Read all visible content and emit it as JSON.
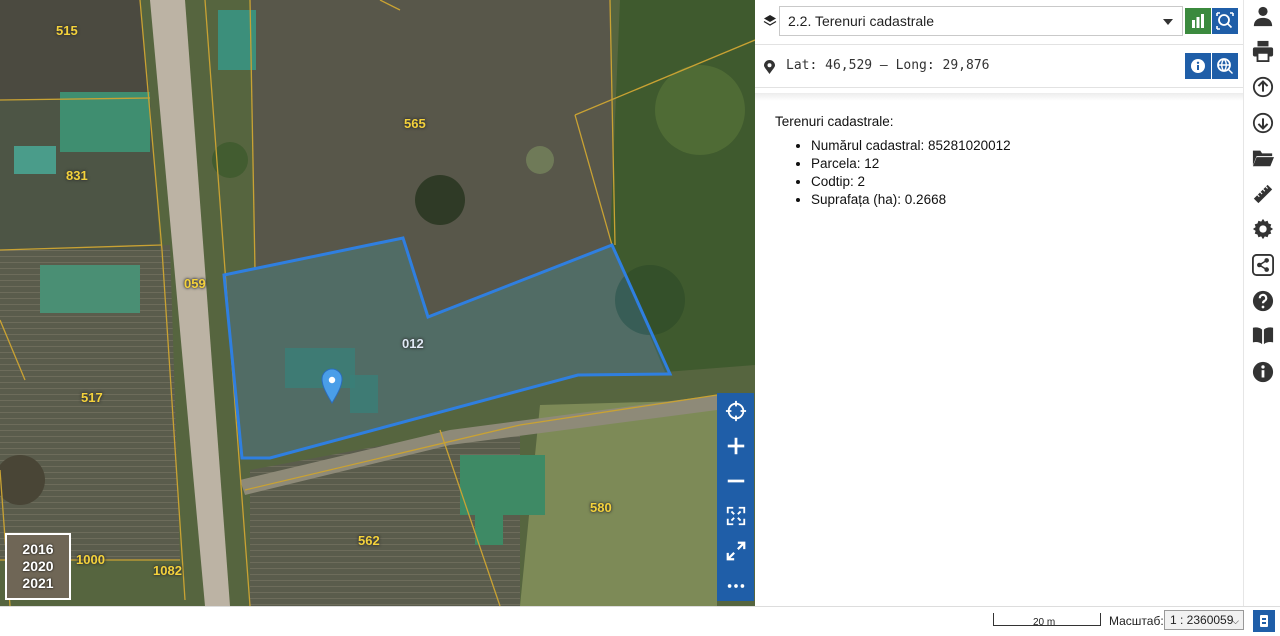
{
  "map": {
    "parcel_labels": [
      "515",
      "565",
      "831",
      "059",
      "012",
      "517",
      "580",
      "562",
      "1000",
      "1082"
    ],
    "years": [
      "2016",
      "2020",
      "2021"
    ],
    "controls": [
      "locate-icon",
      "zoom-in-icon",
      "zoom-out-icon",
      "fullscreen-icon",
      "expand-icon",
      "more-icon"
    ]
  },
  "panel": {
    "layer_select": "2.2. Terenuri cadastrale",
    "coords": "Lat: 46,529 – Long: 29,876",
    "title": "Terenuri cadastrale:",
    "attributes": [
      "Numărul cadastral: 85281020012",
      "Parcela: 12",
      "Codtip: 2",
      "Suprafața (ha): 0.2668"
    ]
  },
  "toolbar": {
    "icons": [
      "user-icon",
      "print-icon",
      "upload-icon",
      "download-icon",
      "folder-icon",
      "ruler-icon",
      "gear-icon",
      "share-icon",
      "help-icon",
      "book-icon",
      "info-icon"
    ]
  },
  "bottom": {
    "scale_bar": "20 m",
    "scale_label": "Масштаб:",
    "scale_value": "1 : 2360059"
  },
  "colors": {
    "accent": "#1f5ea8",
    "green": "#3b8a3e",
    "parcel_label": "#f4d23b",
    "selection": "#2f7fe0"
  }
}
